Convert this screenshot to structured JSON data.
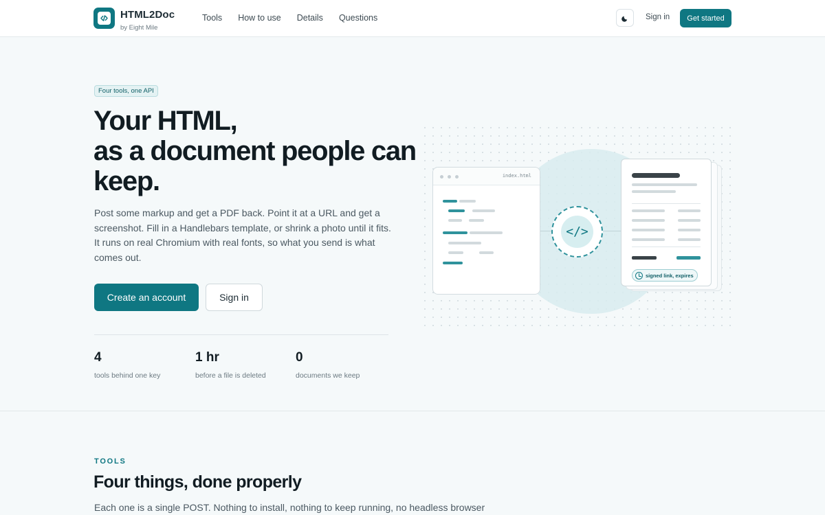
{
  "header": {
    "brand_name": "HTML2Doc",
    "brand_sub": "by Eight Mile",
    "nav": [
      "Tools",
      "How to use",
      "Details",
      "Questions"
    ],
    "signin_label": "Sign in",
    "cta_label": "Get started",
    "theme_icon": "moon-icon"
  },
  "hero": {
    "pill": "Four tools, one API",
    "title_lines": [
      "Your HTML,",
      "as a document people can",
      "keep."
    ],
    "description": "Post some markup and get a PDF back. Point it at a URL and get a screenshot. Fill in a Handlebars template, or shrink a photo until it fits. It runs on real Chromium with real fonts, so what you send is what comes out.",
    "primary_button": "Create an account",
    "secondary_button": "Sign in",
    "stats": [
      {
        "value": "4",
        "label": "tools behind one key"
      },
      {
        "value": "1 hr",
        "label": "before a file is deleted"
      },
      {
        "value": "0",
        "label": "documents we keep"
      }
    ]
  },
  "illustration": {
    "file_name": "index.html",
    "code_symbol": "</>",
    "chip_label": "signed link, expires",
    "chip_icon": "clock-icon"
  },
  "tools": {
    "eyebrow": "TOOLS",
    "title": "Four things, done properly",
    "description": "Each one is a single POST. Nothing to install, nothing to keep running, no headless browser"
  },
  "colors": {
    "accent": "#0f7782",
    "page_bg": "#f5f9fa",
    "heading": "#111c22"
  }
}
